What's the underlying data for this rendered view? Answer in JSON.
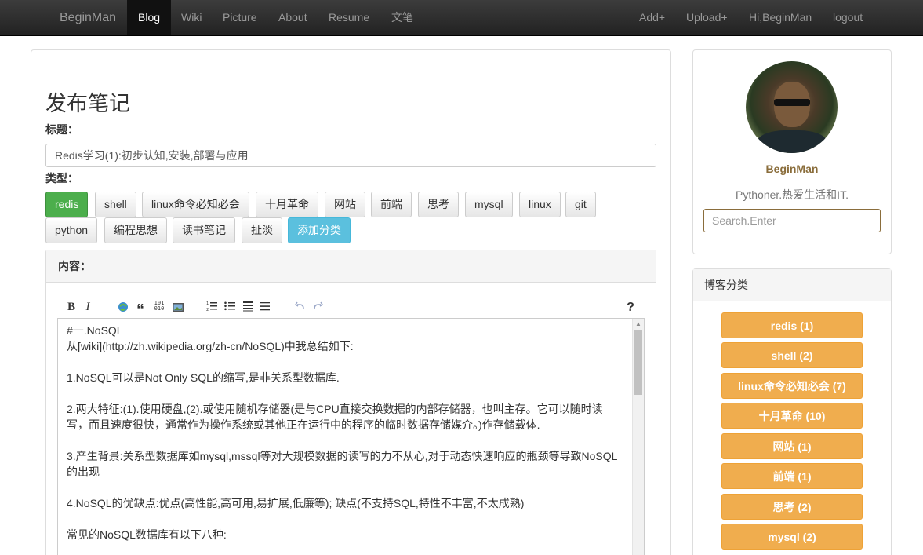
{
  "navbar": {
    "brand": "BeginMan",
    "items": [
      "Blog",
      "Wiki",
      "Picture",
      "About",
      "Resume",
      "文笔"
    ],
    "active": "Blog",
    "right_items": [
      "Add+",
      "Upload+",
      "Hi,BeginMan",
      "logout"
    ]
  },
  "form": {
    "page_title": "发布笔记",
    "title_label": "标题：",
    "title_value": "Redis学习(1):初步认知,安装,部署与应用",
    "type_label": "类型：",
    "tags": [
      "redis",
      "shell",
      "linux命令必知必会",
      "十月革命",
      "网站",
      "前端",
      "思考",
      "mysql",
      "linux",
      "git",
      "python",
      "编程思想",
      "读书笔记",
      "扯淡"
    ],
    "selected_tag": "redis",
    "add_tag_label": "添加分类",
    "content_label": "内容："
  },
  "toolbar": {
    "bold": "B",
    "italic": "I",
    "quote": "“",
    "code": "101\n010",
    "help": "?"
  },
  "editor": {
    "lines": [
      "#一.NoSQL",
      "从[wiki](http://zh.wikipedia.org/zh-cn/NoSQL)中我总结如下:",
      "",
      "1.NoSQL可以是Not Only SQL的缩写,是非关系型数据库.",
      "",
      "2.两大特征:(1).使用硬盘,(2).或使用随机存储器(是与CPU直接交换数据的内部存储器，也叫主存。它可以随时读",
      "写，而且速度很快，通常作为操作系统或其他正在运行中的程序的临时数据存储媒介。)作存储载体.",
      "",
      "3.产生背景:关系型数据库如mysql,mssql等对大规模数据的读写的力不从心,对于动态快速响应的瓶颈等导致NoSQL",
      "的出现",
      "",
      "4.NoSQL的优缺点:优点(高性能,高可用,易扩展,低廉等); 缺点(不支持SQL,特性不丰富,不太成熟)",
      "",
      "常见的NoSQL数据库有以下八种:"
    ]
  },
  "sidebar": {
    "profile_name": "BeginMan",
    "profile_bio": "Pythoner.热爱生活和IT.",
    "search_placeholder": "Search.Enter",
    "categories_heading": "博客分类",
    "categories": [
      "redis (1)",
      "shell (2)",
      "linux命令必知必会 (7)",
      "十月革命 (10)",
      "网站 (1)",
      "前端 (1)",
      "思考 (2)",
      "mysql (2)"
    ]
  }
}
